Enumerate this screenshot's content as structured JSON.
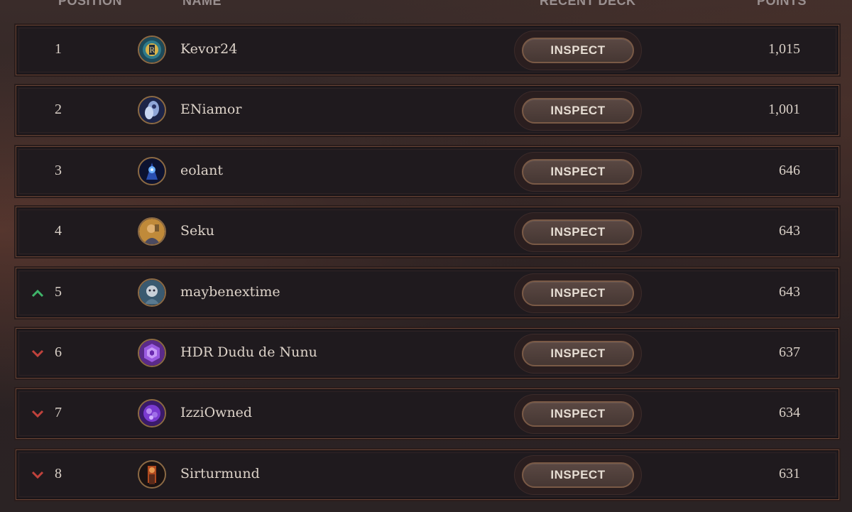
{
  "header": {
    "position": "POSITION",
    "name": "NAME",
    "recent_deck": "RECENT DECK",
    "points": "POINTS"
  },
  "rows": [
    {
      "position": "1",
      "name": "Kevor24",
      "inspect": "INSPECT",
      "points": "1,015",
      "trend": "none"
    },
    {
      "position": "2",
      "name": "ENiamor",
      "inspect": "INSPECT",
      "points": "1,001",
      "trend": "none"
    },
    {
      "position": "3",
      "name": "eolant",
      "inspect": "INSPECT",
      "points": "646",
      "trend": "none"
    },
    {
      "position": "4",
      "name": "Seku",
      "inspect": "INSPECT",
      "points": "643",
      "trend": "none"
    },
    {
      "position": "5",
      "name": "maybenextime",
      "inspect": "INSPECT",
      "points": "643",
      "trend": "up"
    },
    {
      "position": "6",
      "name": "HDR Dudu de Nunu",
      "inspect": "INSPECT",
      "points": "637",
      "trend": "down"
    },
    {
      "position": "7",
      "name": "IzziOwned",
      "inspect": "INSPECT",
      "points": "634",
      "trend": "down"
    },
    {
      "position": "8",
      "name": "Sirturmund",
      "inspect": "INSPECT",
      "points": "631",
      "trend": "down"
    }
  ],
  "colors": {
    "trend_up": "#3fb56a",
    "trend_down": "#c0423c",
    "row_border": "#6a4536"
  }
}
